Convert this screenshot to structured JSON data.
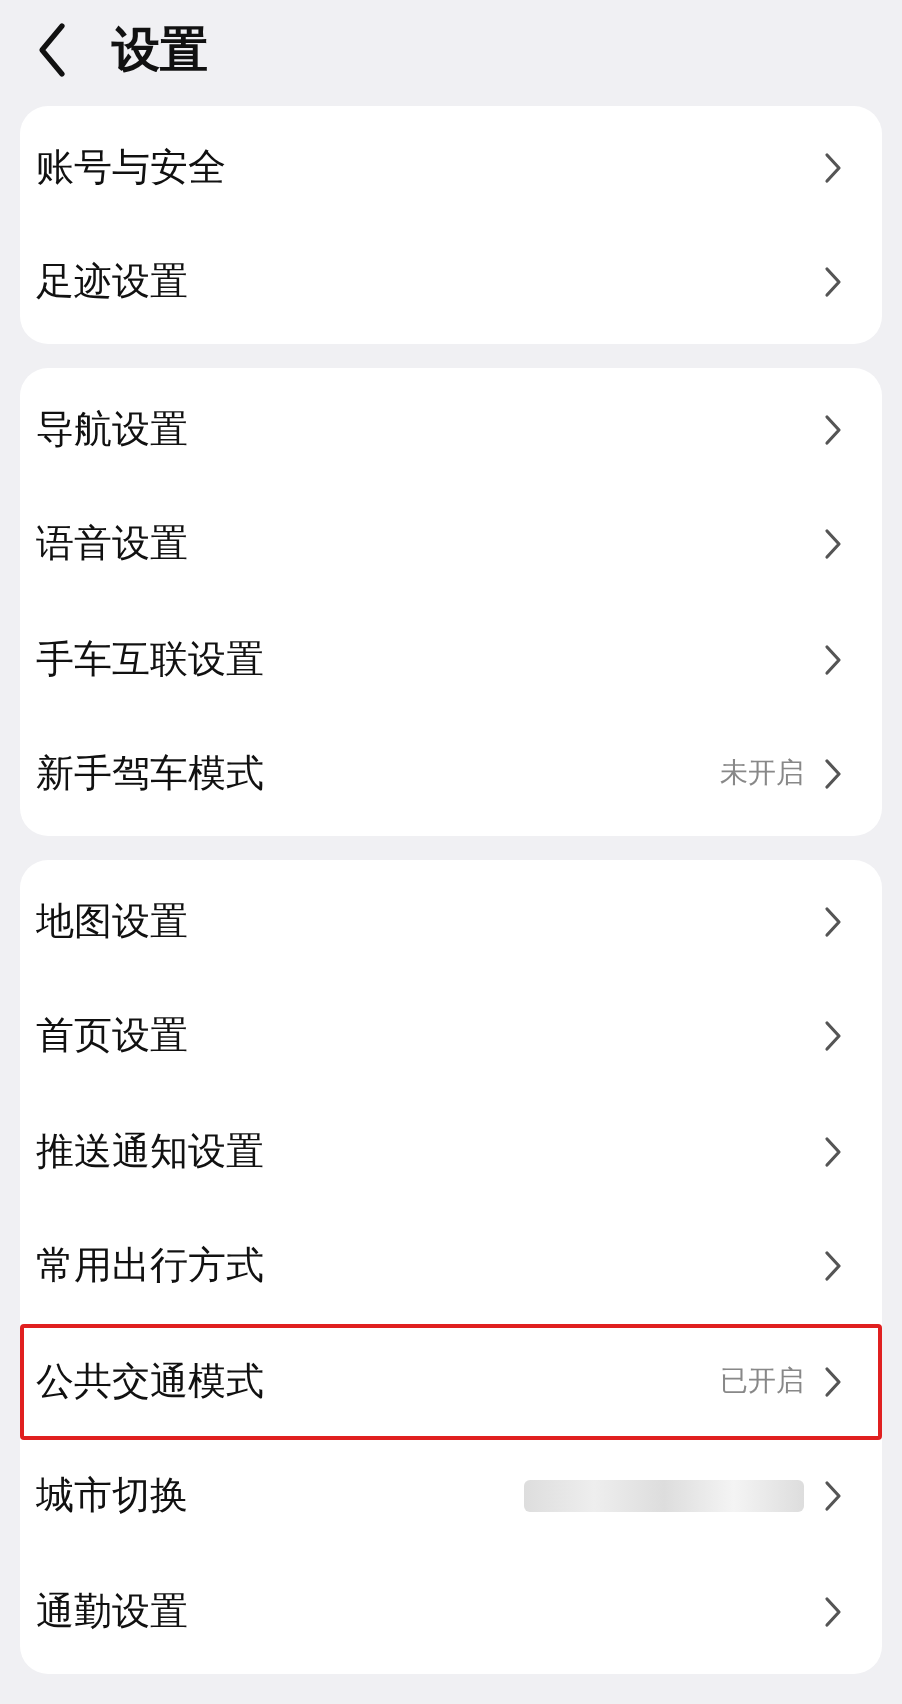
{
  "header": {
    "title": "设置"
  },
  "groups": [
    {
      "items": [
        {
          "label": "账号与安全",
          "highlighted": false
        },
        {
          "label": "足迹设置",
          "highlighted": false
        }
      ]
    },
    {
      "items": [
        {
          "label": "导航设置",
          "highlighted": false
        },
        {
          "label": "语音设置",
          "highlighted": false
        },
        {
          "label": "手车互联设置",
          "highlighted": false
        },
        {
          "label": "新手驾车模式",
          "value": "未开启",
          "highlighted": false
        }
      ]
    },
    {
      "items": [
        {
          "label": "地图设置",
          "highlighted": false
        },
        {
          "label": "首页设置",
          "highlighted": false
        },
        {
          "label": "推送通知设置",
          "highlighted": false
        },
        {
          "label": "常用出行方式",
          "highlighted": false
        },
        {
          "label": "公共交通模式",
          "value": "已开启",
          "highlighted": true
        },
        {
          "label": "城市切换",
          "value_hidden": true,
          "highlighted": false
        },
        {
          "label": "通勤设置",
          "highlighted": false
        }
      ]
    }
  ]
}
